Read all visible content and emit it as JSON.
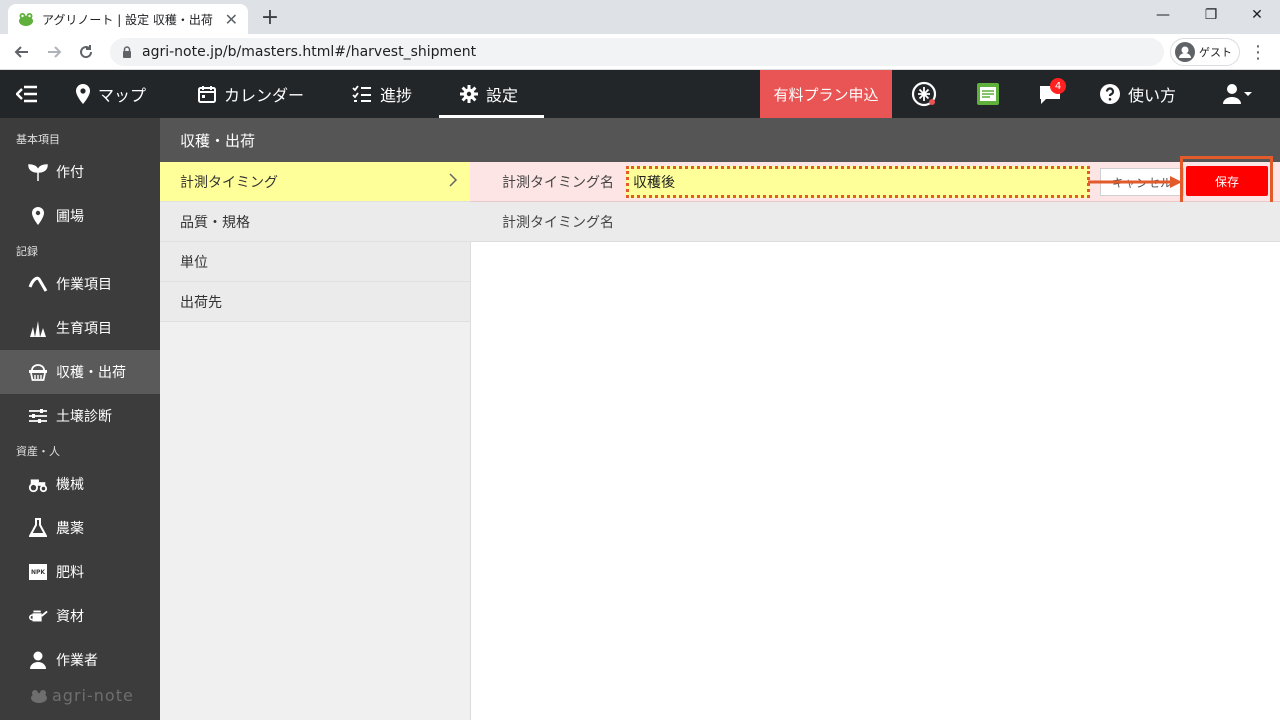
{
  "browser": {
    "tab_title": "アグリノート | 設定 収穫・出荷",
    "tab_close": "✕",
    "new_tab": "+",
    "url": "agri-note.jp/b/masters.html#/harvest_shipment",
    "profile_label": "ゲスト",
    "win_min": "—",
    "win_restore": "❐",
    "win_close": "✕"
  },
  "header": {
    "nav": [
      {
        "label": "マップ"
      },
      {
        "label": "カレンダー"
      },
      {
        "label": "進捗"
      },
      {
        "label": "設定"
      }
    ],
    "paid_plan_label": "有料プラン申込",
    "notification_count": "4",
    "help_label": "使い方"
  },
  "sidebar": {
    "sections": [
      "基本項目",
      "記録",
      "資産・人"
    ],
    "items": [
      {
        "label": "作付"
      },
      {
        "label": "圃場"
      },
      {
        "label": "作業項目"
      },
      {
        "label": "生育項目"
      },
      {
        "label": "収穫・出荷"
      },
      {
        "label": "土壌診断"
      },
      {
        "label": "機械"
      },
      {
        "label": "農薬"
      },
      {
        "label": "肥料"
      },
      {
        "label": "資材"
      },
      {
        "label": "作業者"
      }
    ],
    "npk_label": "NPK",
    "logo_text": "agri-note"
  },
  "page": {
    "title": "収穫・出荷",
    "subnav": [
      {
        "label": "計測タイミング"
      },
      {
        "label": "品質・規格"
      },
      {
        "label": "単位"
      },
      {
        "label": "出荷先"
      }
    ],
    "edit_row": {
      "label": "計測タイミング名",
      "value": "収穫後",
      "cancel_label": "キャンセル",
      "save_label": "保存"
    },
    "list_header": "計測タイミング名"
  },
  "colors": {
    "accent_red": "#ff0000",
    "highlight_orange": "#e35a2b",
    "selected_yellow": "#ffff99",
    "sidebar_bg": "#3c3c3c",
    "header_bg": "#222629"
  }
}
